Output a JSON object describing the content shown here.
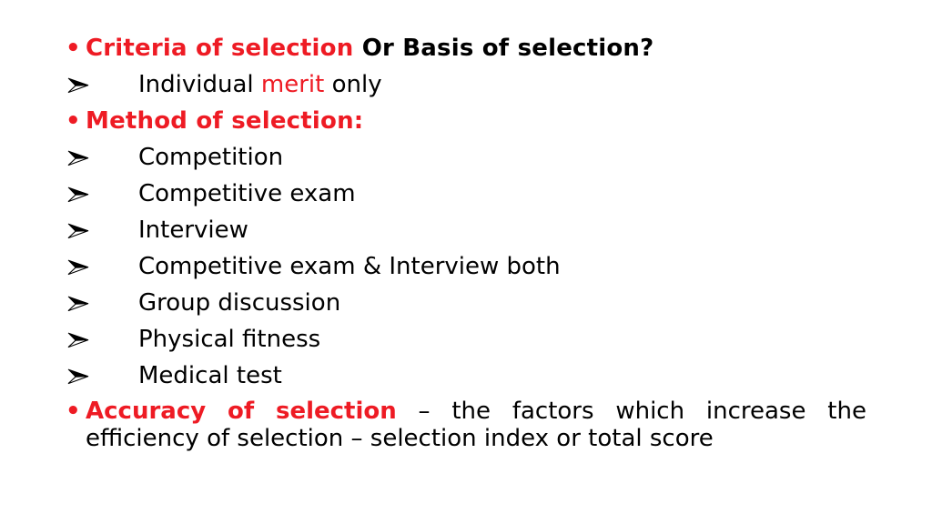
{
  "slide": {
    "background_color": "#ffffff",
    "accent_color": "#ee1b24",
    "text_color": "#000000",
    "bullets": {
      "dot": "•",
      "arrow": "arrow-head-bullet"
    },
    "headings": [
      {
        "red_text": "Criteria of selection",
        "black_text": "Or Basis of selection?"
      },
      {
        "red_text": "Method of selection:",
        "black_text": ""
      }
    ],
    "criteria_items": [
      {
        "prefix": "Individual",
        "highlight": "merit",
        "suffix": "only"
      }
    ],
    "method_items": [
      {
        "label": "Competition"
      },
      {
        "label": "Competitive exam"
      },
      {
        "label": "Interview"
      },
      {
        "label": "Competitive exam & Interview both"
      },
      {
        "label": "Group discussion"
      },
      {
        "label": "Physical fitness"
      },
      {
        "label": "Medical test"
      }
    ],
    "accuracy": {
      "title": "Accuracy of selection",
      "title_words": [
        "Accuracy",
        "of",
        "selection"
      ],
      "line1_words": [
        "–",
        "the",
        "factors",
        "which",
        "increase",
        "the"
      ],
      "line2": "efficiency of selection – selection index or total score"
    }
  }
}
